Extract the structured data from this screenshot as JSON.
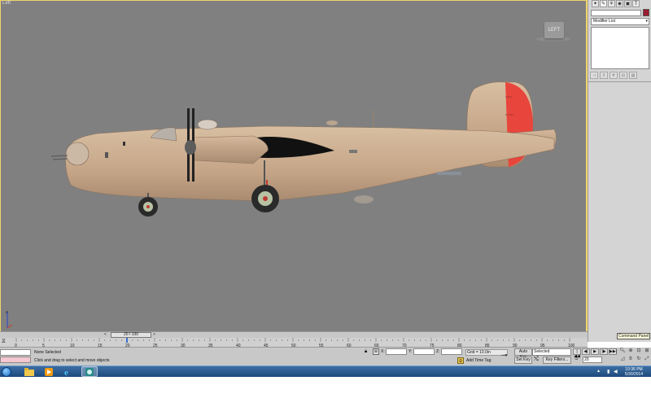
{
  "viewport": {
    "label": "Left",
    "viewcube_label": "LEFT"
  },
  "command_panel": {
    "tabs": [
      "create-icon",
      "modify-icon",
      "hierarchy-icon",
      "motion-icon",
      "display-icon",
      "utilities-icon"
    ],
    "tab_glyphs": [
      "✦",
      "✎",
      "⚘",
      "◉",
      "▣",
      "T"
    ],
    "object_color": "#9b1b30",
    "modifier_list": "Modifier List",
    "tooltip": "Command Panel"
  },
  "time_slider": {
    "value": "20 / 100",
    "current_frame": 20,
    "total_frames": 100,
    "prev": "<",
    "next": ">"
  },
  "track_bar": {
    "ticks": [
      "0",
      "5",
      "10",
      "15",
      "20",
      "25",
      "30",
      "35",
      "40",
      "45",
      "50",
      "55",
      "60",
      "65",
      "70",
      "75",
      "80",
      "85",
      "90",
      "95",
      "100"
    ]
  },
  "status": {
    "selection": "None Selected",
    "prompt": "Click and drag to select and move objects",
    "coord_x_label": "X:",
    "coord_y_label": "Y:",
    "coord_z_label": "Z:",
    "grid": "Grid = 10.0in",
    "add_time_tag": "Add Time Tag"
  },
  "animation": {
    "auto_key": "Auto Key",
    "set_key": "Set Key",
    "key_mode": "Selected",
    "key_filters": "Key Filters...",
    "frame": "20",
    "playback_buttons": [
      "|◀◀",
      "◀|",
      "▶",
      "|▶",
      "▶▶|"
    ]
  },
  "taskbar": {
    "apps": [
      "explorer-icon",
      "media-player-icon",
      "internet-explorer-icon",
      "3dsmax-icon"
    ],
    "time": "10:36 PM",
    "date": "5/30/2014"
  },
  "colors": {
    "viewport_bg": "#808080",
    "fuselage": "#c8a88a",
    "rudder": "#e8453c",
    "active_border": "#f2d36b"
  }
}
